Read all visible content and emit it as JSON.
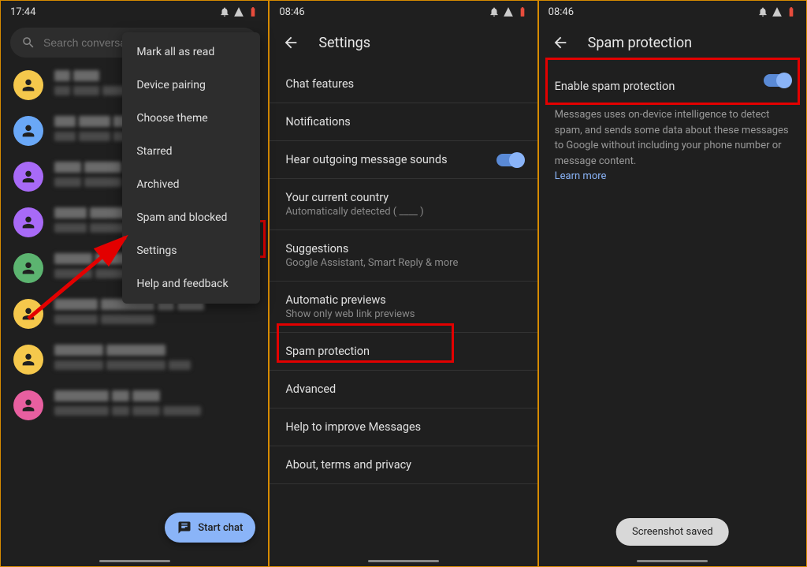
{
  "panel1": {
    "time": "17:44",
    "search_placeholder": "Search conversat",
    "menu": {
      "items": [
        "Mark all as read",
        "Device pairing",
        "Choose theme",
        "Starred",
        "Archived",
        "Spam and blocked",
        "Settings",
        "Help and feedback"
      ]
    },
    "start_chat": "Start chat",
    "avatar_colors": [
      "#f5c84c",
      "#6aa8f7",
      "#a86af7",
      "#a86af7",
      "#5cb470",
      "#f5c84c",
      "#f5c84c",
      "#e85fa0"
    ]
  },
  "panel2": {
    "time": "08:46",
    "title": "Settings",
    "rows": [
      {
        "primary": "Chat features"
      },
      {
        "primary": "Notifications"
      },
      {
        "primary": "Hear outgoing message sounds",
        "toggle": true
      },
      {
        "primary": "Your current country",
        "secondary": "Automatically detected ( ____ )"
      },
      {
        "primary": "Suggestions",
        "secondary": "Google Assistant, Smart Reply & more"
      },
      {
        "primary": "Automatic previews",
        "secondary": "Show only web link previews"
      },
      {
        "primary": "Spam protection"
      },
      {
        "primary": "Advanced"
      },
      {
        "primary": "Help to improve Messages"
      },
      {
        "primary": "About, terms and privacy"
      }
    ]
  },
  "panel3": {
    "time": "08:46",
    "title": "Spam protection",
    "enable_label": "Enable spam protection",
    "description": "Messages uses on-device intelligence to detect spam, and sends some data about these messages to Google without including your phone number or message content.",
    "learn_more": "Learn more",
    "toast": "Screenshot saved"
  }
}
